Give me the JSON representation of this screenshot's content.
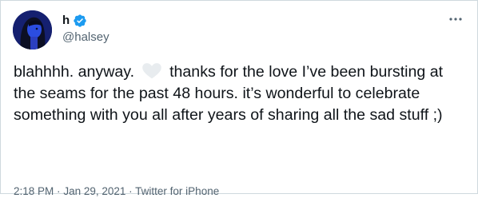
{
  "tweet": {
    "display_name": "h",
    "handle": "@halsey",
    "text_before_emoji": "blahhhh. anyway.",
    "emoji": "white-heart-emoji",
    "text_after_emoji": "thanks for the love I’ve been bursting at the seams for the past 48 hours. it’s wonderful to celebrate something with you all after years of sharing all the sad stuff ;)",
    "time": "2:18 PM",
    "separator": "·",
    "date": "Jan 29, 2021",
    "source": "Twitter for iPhone",
    "verified_color": "#1d9bf0"
  }
}
